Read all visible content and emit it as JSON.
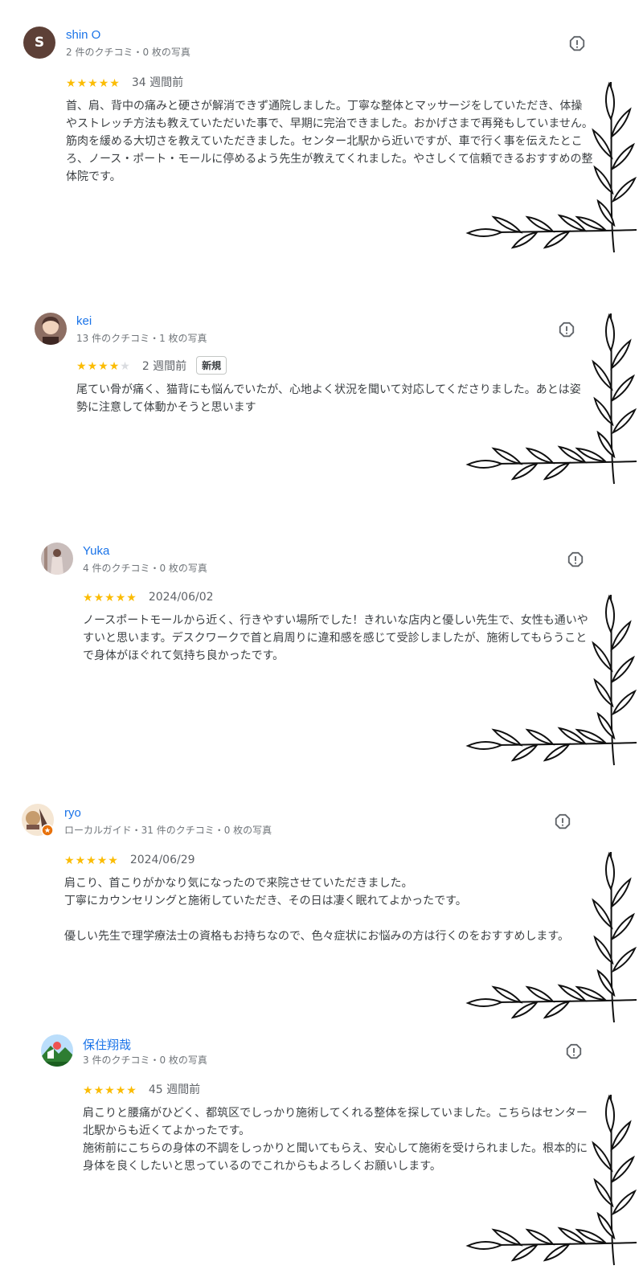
{
  "reviews": [
    {
      "name": "shin O",
      "avatar_letter": "S",
      "meta": "2 件のクチコミ・0 枚の写真",
      "rating": 5,
      "date": "34 週間前",
      "badge": "",
      "text": "首、肩、背中の痛みと硬さが解消できず通院しました。丁寧な整体とマッサージをしていただき、体操やストレッチ方法も教えていただいた事で、早期に完治できました。おかげさまで再発もしていません。筋肉を緩める大切さを教えていただきました。センター北駅から近いですが、車で行く事を伝えたところ、ノース・ポート・モールに停めるよう先生が教えてくれました。やさしくて信頼できるおすすめの整体院です。"
    },
    {
      "name": "kei",
      "meta": "13 件のクチコミ・1 枚の写真",
      "rating": 4,
      "date": "2 週間前",
      "badge": "新規",
      "text": "尾てい骨が痛く、猫背にも悩んでいたが、心地よく状況を聞いて対応してくださりました。あとは姿勢に注意して体動かそうと思います"
    },
    {
      "name": "Yuka",
      "meta": "4 件のクチコミ・0 枚の写真",
      "rating": 5,
      "date": "2024/06/02",
      "badge": "",
      "text": "ノースポートモールから近く、行きやすい場所でした！きれいな店内と優しい先生で、女性も通いやすいと思います。デスクワークで首と肩周りに違和感を感じて受診しましたが、施術してもらうことで身体がほぐれて気持ち良かったです。"
    },
    {
      "name": "ryo",
      "meta": "ローカルガイド・31 件のクチコミ・0 枚の写真",
      "rating": 5,
      "date": "2024/06/29",
      "badge": "",
      "text": "肩こり、首こりがかなり気になったので来院させていただきました。\n丁寧にカウンセリングと施術していただき、その日は凄く眠れてよかったです。\n\n優しい先生で理学療法士の資格もお持ちなので、色々症状にお悩みの方は行くのをおすすめします。"
    },
    {
      "name": "保住翔哉",
      "meta": "3 件のクチコミ・0 枚の写真",
      "rating": 5,
      "date": "45 週間前",
      "badge": "",
      "text": "肩こりと腰痛がひどく、都筑区でしっかり施術してくれる整体を探していました。こちらはセンター北駅からも近くてよかったです。\n施術前にこちらの身体の不調をしっかりと聞いてもらえ、安心して施術を受けられました。根本的に身体を良くしたいと思っているのでこれからもよろしくお願いします。"
    }
  ],
  "icons": {
    "report": "report-flag-icon",
    "star": "star-icon",
    "decoration": "leaf-branch-corner-decoration"
  },
  "colors": {
    "name_link": "#1a73e8",
    "star_on": "#fbbc04",
    "star_off": "#dadce0",
    "avatar_letter_bg": "#5d4037"
  }
}
